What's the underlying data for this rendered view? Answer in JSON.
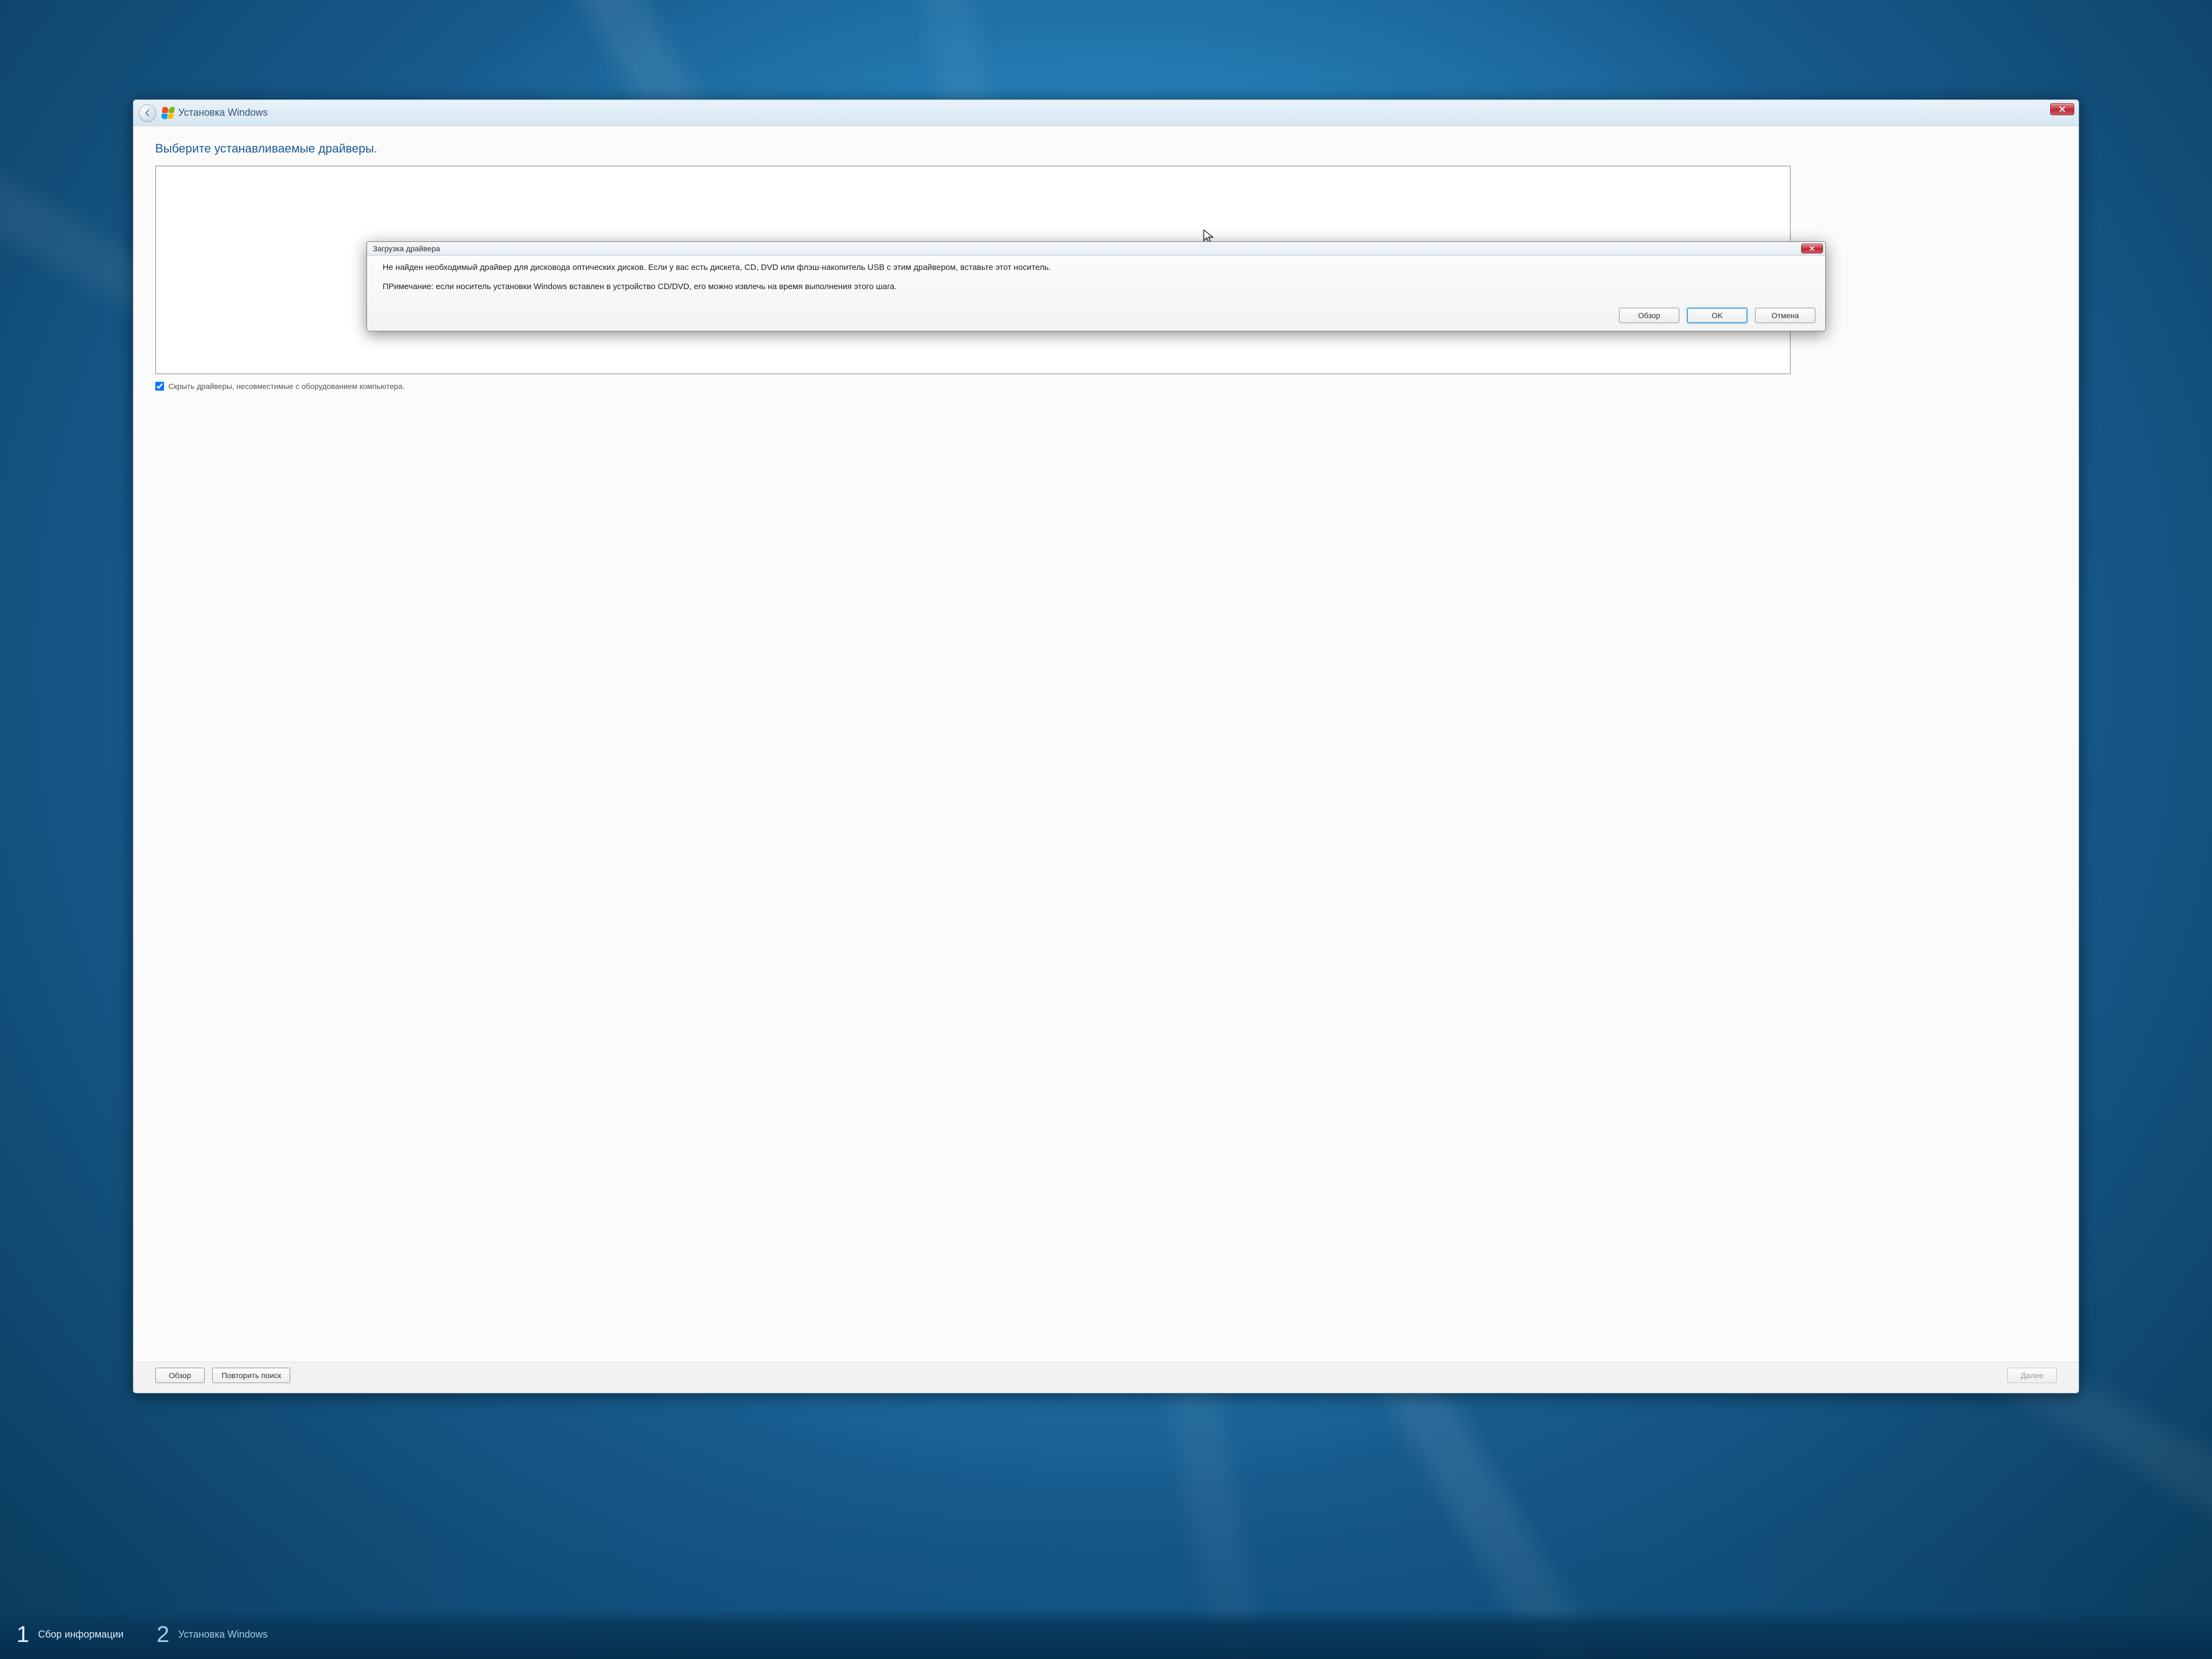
{
  "wizard": {
    "title": "Установка Windows",
    "heading": "Выберите устанавливаемые драйверы.",
    "hide_incompatible_label": "Скрыть драйверы, несовместимые с оборудованием компьютера.",
    "browse_label": "Обзор",
    "rescan_label": "Повторить поиск",
    "next_label": "Далее"
  },
  "modal": {
    "title": "Загрузка драйвера",
    "message": "Не найден необходимый драйвер для дисковода оптических дисков. Если у вас есть дискета, CD, DVD или флэш-накопитель USB с этим драйвером, вставьте этот носитель.",
    "note": "ПРимечание: если носитель установки Windows вставлен в устройство CD/DVD, его можно извлечь на время выполнения этого шага.",
    "browse_label": "Обзор",
    "ok_label": "OK",
    "cancel_label": "Отмена"
  },
  "steps": {
    "step1_num": "1",
    "step1_label": "Сбор информации",
    "step2_num": "2",
    "step2_label": "Установка Windows"
  }
}
